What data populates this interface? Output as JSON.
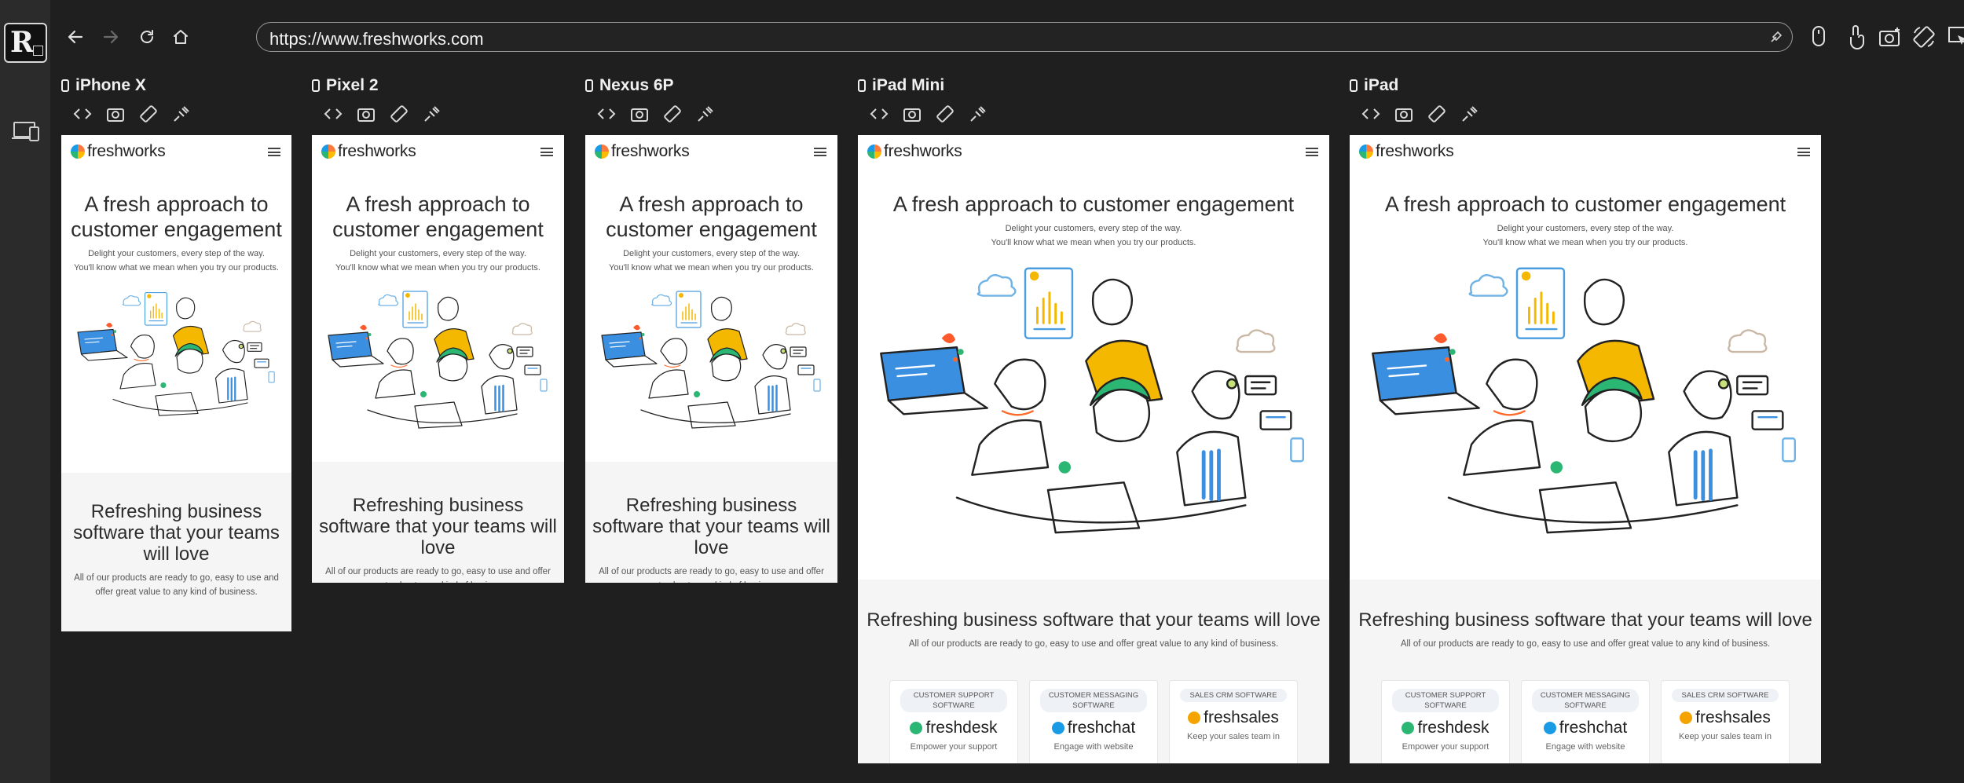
{
  "browser": {
    "url": "https://www.freshworks.com",
    "nav": {
      "back_icon": "back-arrow-icon",
      "forward_icon": "forward-arrow-icon",
      "reload_icon": "reload-icon",
      "home_icon": "home-icon"
    },
    "tools": [
      "mouse-icon",
      "touch-icon",
      "screenshot-icon",
      "rotate-icon",
      "cursor-icon",
      "zoom-in-icon"
    ]
  },
  "devices": [
    {
      "name": "iPhone X"
    },
    {
      "name": "Pixel 2"
    },
    {
      "name": "Nexus 6P"
    },
    {
      "name": "iPad Mini"
    },
    {
      "name": "iPad"
    }
  ],
  "site": {
    "logo": "freshworks",
    "hero_title": "A fresh approach to customer engagement",
    "hero_sub1": "Delight your customers, every step of the way.",
    "hero_sub2": "You'll know what we mean when you try our products.",
    "section_title": "Refreshing business software that your teams will love",
    "section_sub": "All of our products are ready to go, easy to use and offer great value to any kind of business.",
    "cards": [
      {
        "tag": "CUSTOMER SUPPORT SOFTWARE",
        "product": "freshdesk",
        "desc": "Empower your support",
        "color": "#2bb673"
      },
      {
        "tag": "CUSTOMER MESSAGING SOFTWARE",
        "product": "freshchat",
        "desc": "Engage with website",
        "color": "#1a9be6"
      },
      {
        "tag": "SALES CRM SOFTWARE",
        "product": "freshsales",
        "desc": "Keep your sales team in",
        "color": "#f5a300"
      }
    ]
  },
  "colors": {
    "chrome_bg": "#1f1f1f",
    "sidebar_bg": "#2b2b2b",
    "yellow": "#f5b800",
    "green": "#2bb673",
    "blue": "#3b8fe0",
    "orange": "#ff6a2b"
  }
}
